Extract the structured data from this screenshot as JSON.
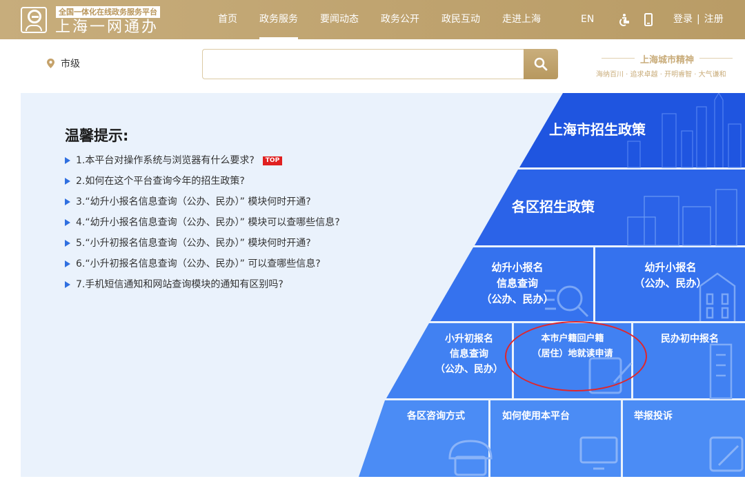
{
  "header": {
    "brand_small": "全国一体化在线政务服务平台",
    "brand_big": "上海一网通办",
    "nav": [
      {
        "label": "首页"
      },
      {
        "label": "政务服务"
      },
      {
        "label": "要闻动态"
      },
      {
        "label": "政务公开"
      },
      {
        "label": "政民互动"
      },
      {
        "label": "走进上海"
      }
    ],
    "active_nav": "政务服务",
    "lang": "EN",
    "login": "登录",
    "register": "注册",
    "login_sep": "|"
  },
  "search": {
    "location": "市级",
    "placeholder": "",
    "value": ""
  },
  "spirit": {
    "title": "上海城市精神",
    "subtitle": "海纳百川 · 追求卓越 · 开明睿智 · 大气谦和"
  },
  "tips": {
    "title": "温馨提示:",
    "top_badge": "TOP",
    "items": [
      "1.本平台对操作系统与浏览器有什么要求?",
      "2.如何在这个平台查询今年的招生政策?",
      "3.“幼升小报名信息查询（公办、民办）” 模块何时开通?",
      "4.“幼升小报名信息查询（公办、民办）” 模块可以查哪些信息?",
      "5.“小升初报名信息查询（公办、民办）” 模块何时开通?",
      "6.“小升初报名信息查询（公办、民办）” 可以查哪些信息?",
      "7.手机短信通知和网站查询模块的通知有区别吗?"
    ]
  },
  "tiles": {
    "city_policy": "上海市招生政策",
    "district_policy": "各区招生政策",
    "kg_query_l1": "幼升小报名",
    "kg_query_l2": "信息查询",
    "kg_query_l3": "（公办、民办）",
    "kg_register_l1": "幼升小报名",
    "kg_register_l2": "（公办、民办）",
    "ps_query_l1": "小升初报名",
    "ps_query_l2": "信息查询",
    "ps_query_l3": "（公办、民办）",
    "hukou_l1": "本市户籍回户籍",
    "hukou_l2": "（居住）地就读申请",
    "private_middle": "民办初中报名",
    "district_consult": "各区咨询方式",
    "how_to_use": "如何使用本平台",
    "report": "举报投诉"
  },
  "colors": {
    "gold": "#bfa36f",
    "blue_dark": "#1f55e0",
    "blue_mid": "#3772ec",
    "blue_light": "#4a8af4",
    "panel_bg": "#eaf2fc",
    "highlight": "#e0262b"
  }
}
